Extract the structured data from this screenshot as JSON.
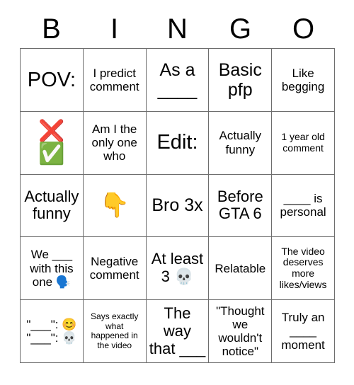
{
  "card": {
    "title_letters": [
      "B",
      "I",
      "N",
      "G",
      "O"
    ],
    "grid_colors": {
      "border": "#6d6d6d",
      "background": "#ffffff",
      "text": "#000000"
    },
    "rows": [
      [
        {
          "text": "POV:",
          "size": "fs-xxl"
        },
        {
          "text": "I predict comment",
          "size": "fs-md"
        },
        {
          "text": "As a\n____",
          "size": "fs-xl"
        },
        {
          "text": "Basic pfp",
          "size": "fs-xl"
        },
        {
          "text": "Like begging",
          "size": "fs-md"
        }
      ],
      [
        {
          "text": "❌\n✅",
          "size": "emoji-stack"
        },
        {
          "text": "Am I the only one who",
          "size": "fs-md"
        },
        {
          "text": "Edit:",
          "size": "fs-xxl"
        },
        {
          "text": "Actually funny",
          "size": "fs-md"
        },
        {
          "text": "1 year old comment",
          "size": "fs-sm"
        }
      ],
      [
        {
          "text": "Actually funny",
          "size": "fs-lg"
        },
        {
          "text": "👇",
          "size": "emoji-only"
        },
        {
          "text": "Bro 3x",
          "size": "fs-xl"
        },
        {
          "text": "Before GTA 6",
          "size": "fs-lg"
        },
        {
          "text": "____ is personal",
          "size": "fs-md"
        }
      ],
      [
        {
          "text": "We ___ with this one 🗣️",
          "size": "fs-md"
        },
        {
          "text": "Negative comment",
          "size": "fs-md"
        },
        {
          "text": "At least 3 💀",
          "size": "fs-lg"
        },
        {
          "text": "Relatable",
          "size": "fs-md"
        },
        {
          "text": "The video deserves more likes/views",
          "size": "fs-sm"
        }
      ],
      [
        {
          "text": "\"___\": 😊\n\"___\": 💀",
          "size": "fs-md"
        },
        {
          "text": "Says exactly what happened in the video",
          "size": "fs-xs"
        },
        {
          "text": "The way that ___",
          "size": "fs-lg"
        },
        {
          "text": "\"Thought we wouldn't notice\"",
          "size": "fs-md"
        },
        {
          "text": "Truly an ____ moment",
          "size": "fs-md"
        }
      ]
    ]
  }
}
